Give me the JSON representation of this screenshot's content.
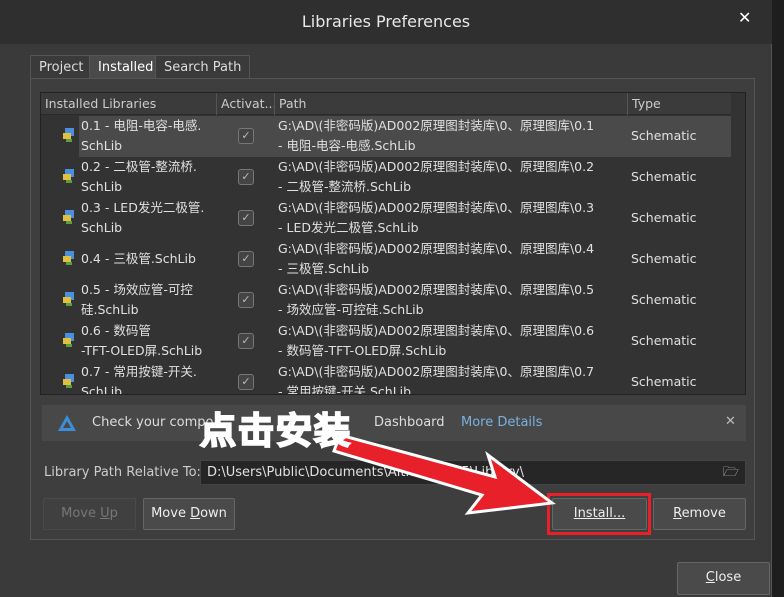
{
  "window": {
    "title": "Libraries Preferences",
    "close_glyph": "✕"
  },
  "tabs": [
    {
      "label": "Project"
    },
    {
      "label": "Installed",
      "active": true
    },
    {
      "label": "Search Path"
    }
  ],
  "table": {
    "headers": [
      "Installed Libraries",
      "Activat...",
      "Path",
      "Type"
    ],
    "rows": [
      {
        "name1": "0.1 - 电阻-电容-电感.",
        "name2": "SchLib",
        "active": true,
        "path1": "G:\\AD\\(非密码版)AD002原理图封装库\\0、原理图库\\0.1",
        "path2": "- 电阻-电容-电感.SchLib",
        "type": "Schematic"
      },
      {
        "name1": "0.2 - 二极管-整流桥.",
        "name2": "SchLib",
        "active": true,
        "path1": "G:\\AD\\(非密码版)AD002原理图封装库\\0、原理图库\\0.2",
        "path2": "- 二极管-整流桥.SchLib",
        "type": "Schematic"
      },
      {
        "name1": "0.3 - LED发光二极管.",
        "name2": "SchLib",
        "active": true,
        "path1": "G:\\AD\\(非密码版)AD002原理图封装库\\0、原理图库\\0.3",
        "path2": "- LED发光二极管.SchLib",
        "type": "Schematic"
      },
      {
        "name1": "0.4 - 三极管.SchLib",
        "name2": "",
        "active": true,
        "path1": "G:\\AD\\(非密码版)AD002原理图封装库\\0、原理图库\\0.4",
        "path2": "- 三极管.SchLib",
        "type": "Schematic"
      },
      {
        "name1": "0.5 - 场效应管-可控",
        "name2": "硅.SchLib",
        "active": true,
        "path1": "G:\\AD\\(非密码版)AD002原理图封装库\\0、原理图库\\0.5",
        "path2": "- 场效应管-可控硅.SchLib",
        "type": "Schematic"
      },
      {
        "name1": "0.6 - 数码管",
        "name2": "-TFT-OLED屏.SchLib",
        "active": true,
        "path1": "G:\\AD\\(非密码版)AD002原理图封装库\\0、原理图库\\0.6",
        "path2": "- 数码管-TFT-OLED屏.SchLib",
        "type": "Schematic"
      },
      {
        "name1": "0.7 - 常用按键-开关.",
        "name2": "SchLib",
        "active": true,
        "path1": "G:\\AD\\(非密码版)AD002原理图封装库\\0、原理图库\\0.7",
        "path2": "- 常用按键-开关.SchLib",
        "type": "Schematic"
      }
    ]
  },
  "banner": {
    "text_start": "Check your compo",
    "text_end": "Dashboard",
    "link": "More Details",
    "close_glyph": "✕"
  },
  "library_path": {
    "label": "Library Path Relative To:",
    "value": "D:\\Users\\Public\\Documents\\Altium\\AD25\\Library\\"
  },
  "buttons": {
    "move_up_pre": "Move ",
    "move_up_u": "U",
    "move_up_post": "p",
    "move_down_pre": "Move ",
    "move_down_u": "D",
    "move_down_post": "own",
    "install": "Install...",
    "remove_u": "R",
    "remove_post": "emove",
    "close_u": "C",
    "close_post": "lose"
  },
  "annotation": {
    "text": "点击安装",
    "color": "#e8202a"
  }
}
